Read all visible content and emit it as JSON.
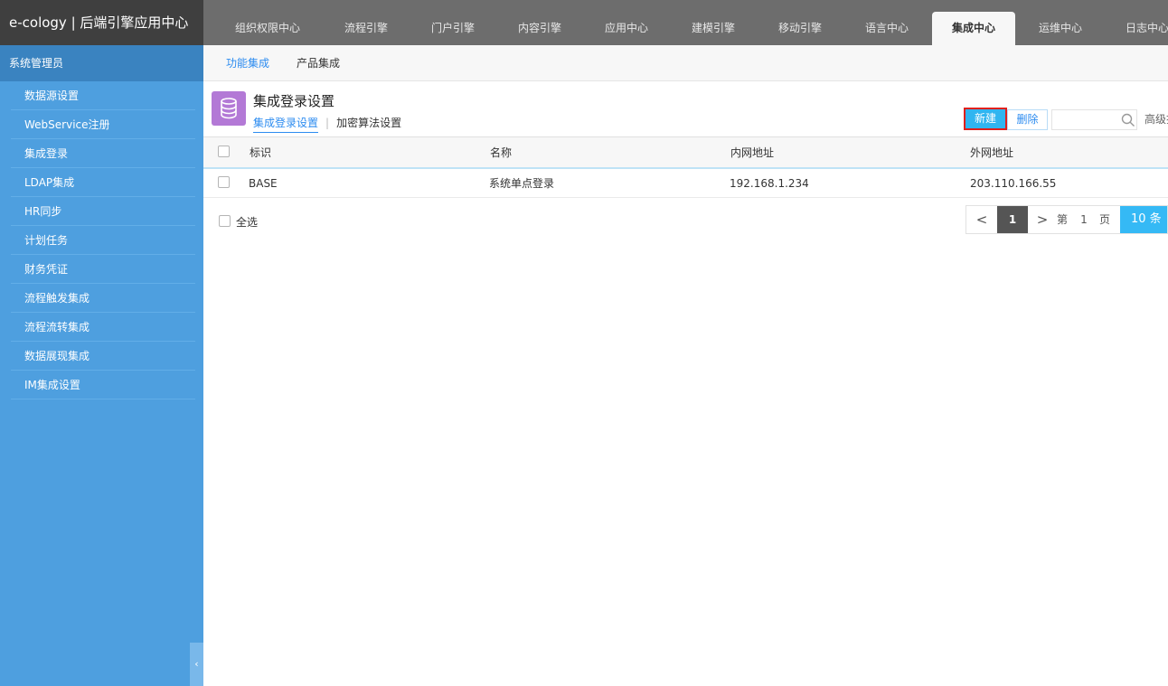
{
  "brand": {
    "title": "e-cology | 后端引擎应用中心"
  },
  "top_tabs": [
    {
      "label": "组织权限中心",
      "active": false
    },
    {
      "label": "流程引擎",
      "active": false
    },
    {
      "label": "门户引擎",
      "active": false
    },
    {
      "label": "内容引擎",
      "active": false
    },
    {
      "label": "应用中心",
      "active": false
    },
    {
      "label": "建模引擎",
      "active": false
    },
    {
      "label": "移动引擎",
      "active": false
    },
    {
      "label": "语言中心",
      "active": false
    },
    {
      "label": "集成中心",
      "active": true
    },
    {
      "label": "运维中心",
      "active": false
    },
    {
      "label": "日志中心",
      "active": false
    }
  ],
  "sidebar": {
    "header": "系统管理员",
    "items": [
      {
        "label": "数据源设置"
      },
      {
        "label": "WebService注册"
      },
      {
        "label": "集成登录"
      },
      {
        "label": "LDAP集成"
      },
      {
        "label": "HR同步"
      },
      {
        "label": "计划任务"
      },
      {
        "label": "财务凭证"
      },
      {
        "label": "流程触发集成"
      },
      {
        "label": "流程流转集成"
      },
      {
        "label": "数据展现集成"
      },
      {
        "label": "IM集成设置"
      }
    ],
    "collapse_glyph": "‹"
  },
  "subnav": [
    {
      "label": "功能集成",
      "active": true
    },
    {
      "label": "产品集成",
      "active": false
    }
  ],
  "page": {
    "title": "集成登录设置",
    "tabs": [
      {
        "label": "集成登录设置",
        "active": true
      },
      {
        "label": "加密算法设置",
        "active": false
      }
    ],
    "separator": "|",
    "icon": "database-icon",
    "accent_color": "#b379d6"
  },
  "toolbar": {
    "new_label": "新建",
    "delete_label": "删除",
    "search_value": "",
    "advanced_label": "高级搜索"
  },
  "table": {
    "columns": [
      "标识",
      "名称",
      "内网地址",
      "外网地址"
    ],
    "rows": [
      {
        "id": "BASE",
        "name": "系统单点登录",
        "intranet": "192.168.1.234",
        "extranet": "203.110.166.55"
      }
    ]
  },
  "footer": {
    "select_all_label": "全选"
  },
  "pager": {
    "prev": "<",
    "current": "1",
    "next": ">",
    "di": "第",
    "page_input": "1",
    "ye": "页",
    "page_size": "10 条"
  },
  "colors": {
    "topbar": "#6d6d6d",
    "brand_bg": "#3f3f3f",
    "sidebar": "#4e9fdf",
    "primary_button": "#30b5f0",
    "highlight_border": "#e0201b",
    "link": "#2d8cf0"
  }
}
